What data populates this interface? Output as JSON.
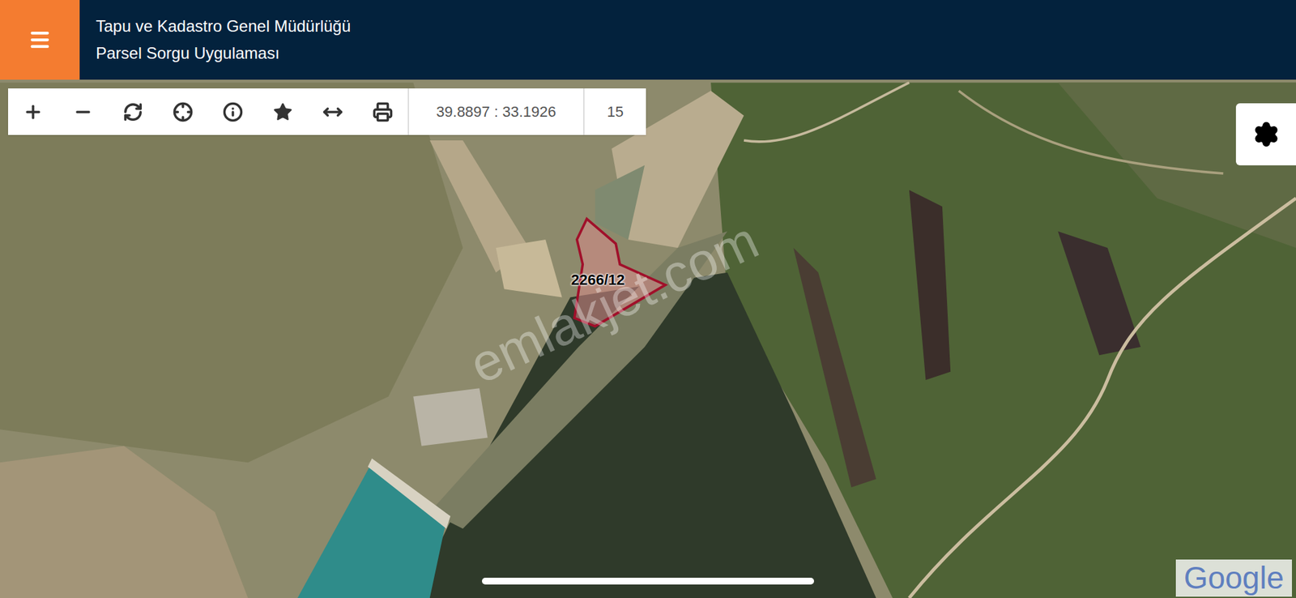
{
  "header": {
    "title_lines": [
      "Tapu ve Kadastro Genel Müdürlüğü",
      "Parsel Sorgu Uygulaması"
    ]
  },
  "toolbar": {
    "coordinates": "39.8897 : 33.1926",
    "zoom": "15"
  },
  "map": {
    "parcel_label": "2266/12",
    "watermark": "emlakjet.com",
    "attribution": "Google"
  }
}
